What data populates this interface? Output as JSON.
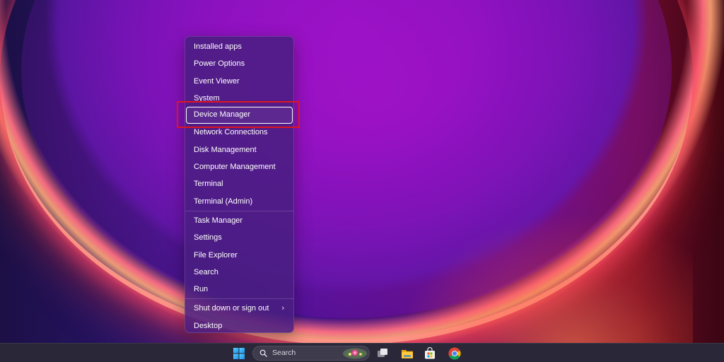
{
  "menu": {
    "groups": [
      {
        "items": [
          {
            "label": "Installed apps"
          },
          {
            "label": "Power Options"
          },
          {
            "label": "Event Viewer"
          },
          {
            "label": "System"
          },
          {
            "label": "Device Manager"
          },
          {
            "label": "Network Connections"
          },
          {
            "label": "Disk Management"
          },
          {
            "label": "Computer Management"
          },
          {
            "label": "Terminal"
          },
          {
            "label": "Terminal (Admin)"
          }
        ]
      },
      {
        "items": [
          {
            "label": "Task Manager"
          },
          {
            "label": "Settings"
          },
          {
            "label": "File Explorer"
          },
          {
            "label": "Search"
          },
          {
            "label": "Run"
          }
        ]
      },
      {
        "items": [
          {
            "label": "Shut down or sign out",
            "submenu_icon": "chevron-right-icon"
          },
          {
            "label": "Desktop"
          }
        ]
      }
    ],
    "focused_item": "Device Manager",
    "highlight_color": "#e0141e"
  },
  "taskbar": {
    "search_label": "Search",
    "icons": [
      "windows-logo-icon",
      "search-icon",
      "task-view-icon",
      "folder-icon",
      "store-icon",
      "chrome-icon"
    ]
  },
  "colors": {
    "menu_background": "#481e80",
    "taskbar_background": "#2a2838",
    "text": "#ffffff"
  }
}
